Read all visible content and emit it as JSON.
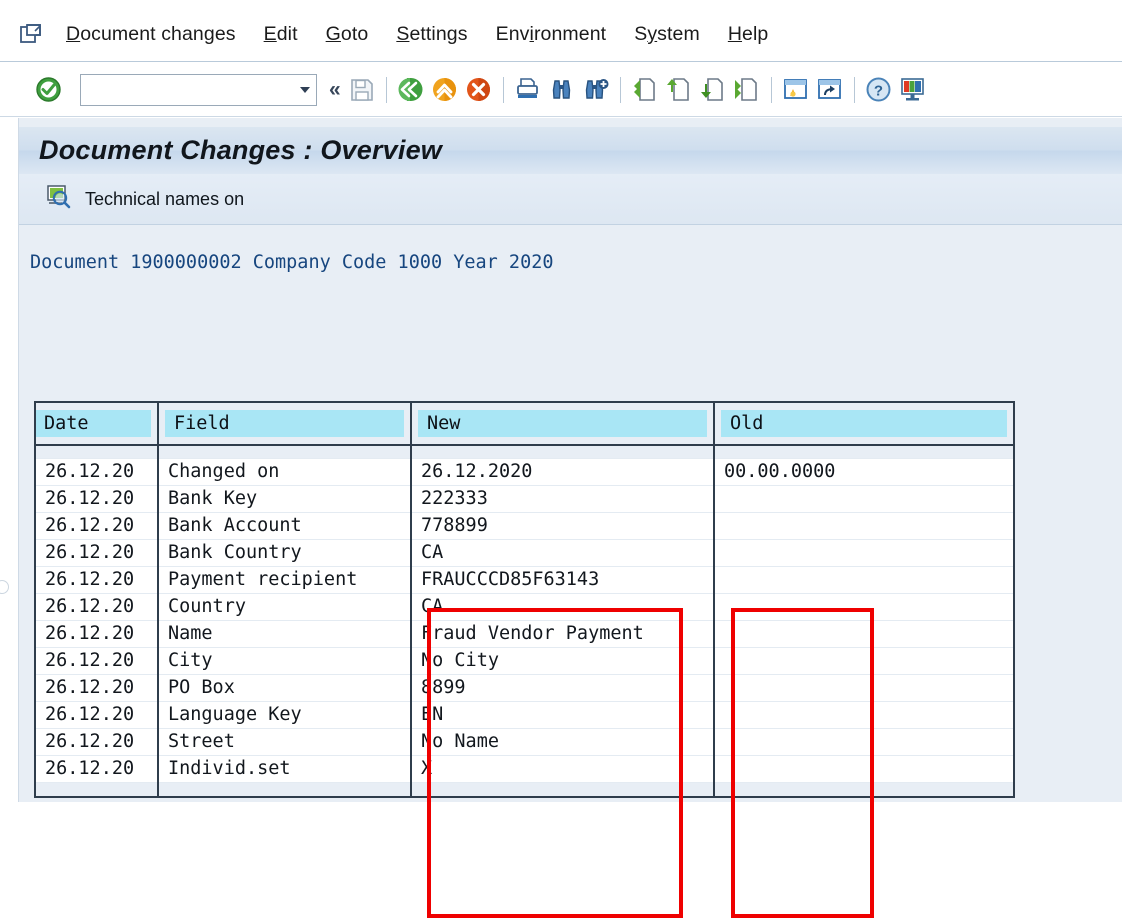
{
  "window": {
    "system_icon": "system-menu-icon"
  },
  "menubar": {
    "items": [
      {
        "name": "menu-document-changes",
        "pre": "D",
        "accel": "",
        "label": "Document changes",
        "underline_index": 0
      },
      {
        "name": "menu-edit",
        "label": "Edit",
        "underline_index": 0
      },
      {
        "name": "menu-goto",
        "label": "Goto",
        "underline_index": 0
      },
      {
        "name": "menu-settings",
        "label": "Settings",
        "underline_index": 0
      },
      {
        "name": "menu-environment",
        "label": "Environment",
        "underline_index": 3
      },
      {
        "name": "menu-system",
        "label": "System",
        "underline_index": 1
      },
      {
        "name": "menu-help",
        "label": "Help",
        "underline_index": 0
      }
    ]
  },
  "toolbar": {
    "ok_icon": "enter-ok-icon",
    "command_field": {
      "value": "",
      "placeholder": ""
    },
    "command_dropdown_icon": "chevron-down-icon",
    "collapse_icon": "double-chevron-left-icon",
    "buttons": [
      {
        "name": "save-button",
        "icon": "save-floppy-icon",
        "label": "Save"
      },
      {
        "name": "back-button",
        "icon": "back-green-arrow-icon",
        "label": "Back"
      },
      {
        "name": "exit-button",
        "icon": "exit-yellow-arrow-icon",
        "label": "Exit"
      },
      {
        "name": "cancel-button",
        "icon": "cancel-red-x-icon",
        "label": "Cancel"
      },
      {
        "name": "print-button",
        "icon": "print-icon",
        "label": "Print"
      },
      {
        "name": "find-button",
        "icon": "find-binoculars-icon",
        "label": "Find"
      },
      {
        "name": "find-next-button",
        "icon": "find-next-binoculars-icon",
        "label": "Find Next"
      },
      {
        "name": "first-page-button",
        "icon": "first-page-icon",
        "label": "First Page"
      },
      {
        "name": "previous-page-button",
        "icon": "previous-page-icon",
        "label": "Previous Page"
      },
      {
        "name": "next-page-button",
        "icon": "next-page-icon",
        "label": "Next Page"
      },
      {
        "name": "last-page-button",
        "icon": "last-page-icon",
        "label": "Last Page"
      },
      {
        "name": "create-session-button",
        "icon": "create-session-icon",
        "label": "Create New Session"
      },
      {
        "name": "create-shortcut-button",
        "icon": "create-shortcut-icon",
        "label": "Create Shortcut"
      },
      {
        "name": "help-button",
        "icon": "help-question-icon",
        "label": "Help"
      },
      {
        "name": "customize-layout-button",
        "icon": "customize-local-layout-icon",
        "label": "Customizing of Local Layout"
      }
    ]
  },
  "screen": {
    "title": "Document Changes : Overview",
    "app_toolbar": {
      "technical_names": {
        "icon": "technical-names-magnifier-icon",
        "label": "Technical names on"
      }
    },
    "document_header": "Document 1900000002 Company Code 1000 Year 2020",
    "document_header_parts": {
      "document_label": "Document",
      "document_number": "1900000002",
      "company_code_label": "Company Code",
      "company_code": "1000",
      "year_label": "Year",
      "year": "2020"
    }
  },
  "table": {
    "columns": [
      {
        "name": "column-date",
        "label": "Date"
      },
      {
        "name": "column-field",
        "label": "Field"
      },
      {
        "name": "column-new",
        "label": "New"
      },
      {
        "name": "column-old",
        "label": "Old"
      }
    ],
    "rows": [
      {
        "date": "26.12.20",
        "field": "Changed on",
        "new": "26.12.2020",
        "old": "00.00.0000"
      },
      {
        "date": "26.12.20",
        "field": "Bank Key",
        "new": "222333",
        "old": ""
      },
      {
        "date": "26.12.20",
        "field": "Bank Account",
        "new": "778899",
        "old": ""
      },
      {
        "date": "26.12.20",
        "field": "Bank Country",
        "new": "CA",
        "old": ""
      },
      {
        "date": "26.12.20",
        "field": "Payment recipient",
        "new": "FRAUCCCD85F63143",
        "old": ""
      },
      {
        "date": "26.12.20",
        "field": "Country",
        "new": "CA",
        "old": ""
      },
      {
        "date": "26.12.20",
        "field": "Name",
        "new": "Fraud Vendor Payment",
        "old": ""
      },
      {
        "date": "26.12.20",
        "field": "City",
        "new": "No City",
        "old": ""
      },
      {
        "date": "26.12.20",
        "field": "PO Box",
        "new": "8899",
        "old": ""
      },
      {
        "date": "26.12.20",
        "field": "Language Key",
        "new": "EN",
        "old": ""
      },
      {
        "date": "26.12.20",
        "field": "Street",
        "new": "No Name",
        "old": ""
      },
      {
        "date": "26.12.20",
        "field": "Individ.set",
        "new": "X",
        "old": ""
      }
    ]
  },
  "annotations": [
    {
      "name": "highlight-box-new-column",
      "color": "#ef0000"
    },
    {
      "name": "highlight-box-old-column",
      "color": "#ef0000"
    }
  ],
  "colors": {
    "header_cell": "#a9e6f5",
    "annotation": "#ef0000",
    "link_text": "#17467f",
    "window_bg": "#e8eef5"
  }
}
